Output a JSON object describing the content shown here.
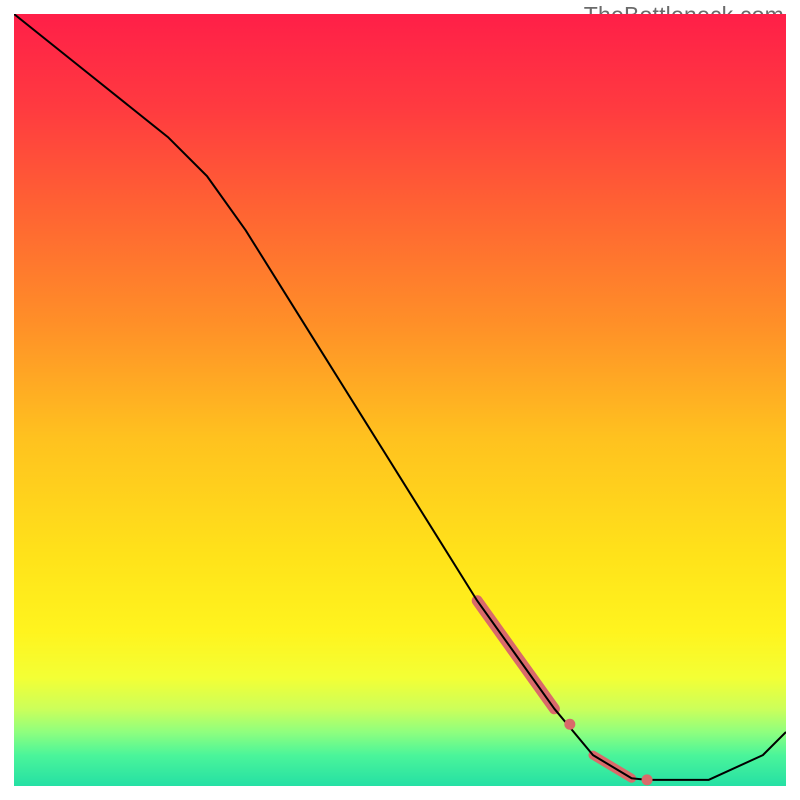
{
  "watermark": "TheBottleneck.com",
  "chart_data": {
    "type": "line",
    "title": "",
    "xlabel": "",
    "ylabel": "",
    "xlim": [
      0,
      100
    ],
    "ylim": [
      0,
      100
    ],
    "grid": false,
    "legend": false,
    "series": [
      {
        "name": "main-curve",
        "color": "#000000",
        "stroke_width": 2,
        "x": [
          0,
          5,
          10,
          15,
          20,
          25,
          30,
          35,
          40,
          45,
          50,
          55,
          60,
          65,
          70,
          75,
          80,
          82,
          85,
          90,
          97,
          100
        ],
        "y": [
          100,
          96,
          92,
          88,
          84,
          79,
          72,
          64,
          56,
          48,
          40,
          32,
          24,
          17,
          10,
          4,
          1,
          0.8,
          0.8,
          0.8,
          4,
          7
        ]
      },
      {
        "name": "highlight-segment-upper",
        "color": "#d96a6a",
        "stroke_width": 11,
        "cap": "round",
        "x": [
          60,
          61,
          62,
          63,
          64,
          65,
          66,
          67,
          68,
          69,
          70
        ],
        "y": [
          24,
          22.6,
          21.2,
          19.8,
          18.4,
          17,
          15.6,
          14.2,
          12.8,
          11.4,
          10
        ]
      },
      {
        "name": "highlight-segment-lower",
        "color": "#d96a6a",
        "stroke_width": 9,
        "cap": "round",
        "x": [
          75,
          76,
          77,
          78,
          79,
          80
        ],
        "y": [
          4,
          3.4,
          2.8,
          2.2,
          1.6,
          1
        ]
      }
    ],
    "markers": [
      {
        "name": "dot-upper-break",
        "x": 72,
        "y": 8,
        "r": 5.5,
        "color": "#d96a6a"
      },
      {
        "name": "dot-flat-point",
        "x": 82,
        "y": 0.8,
        "r": 5.5,
        "color": "#d96a6a"
      }
    ],
    "background_gradient": {
      "direction": "vertical",
      "stops": [
        {
          "pos": 0.0,
          "color": "#ff1f48"
        },
        {
          "pos": 0.12,
          "color": "#ff3a40"
        },
        {
          "pos": 0.25,
          "color": "#ff6233"
        },
        {
          "pos": 0.4,
          "color": "#ff8f28"
        },
        {
          "pos": 0.55,
          "color": "#ffc21f"
        },
        {
          "pos": 0.7,
          "color": "#ffe21a"
        },
        {
          "pos": 0.8,
          "color": "#fff41e"
        },
        {
          "pos": 0.86,
          "color": "#f3ff35"
        },
        {
          "pos": 0.9,
          "color": "#ccff5a"
        },
        {
          "pos": 0.93,
          "color": "#8fff7e"
        },
        {
          "pos": 0.96,
          "color": "#4bf59a"
        },
        {
          "pos": 1.0,
          "color": "#25e0a4"
        }
      ]
    }
  }
}
